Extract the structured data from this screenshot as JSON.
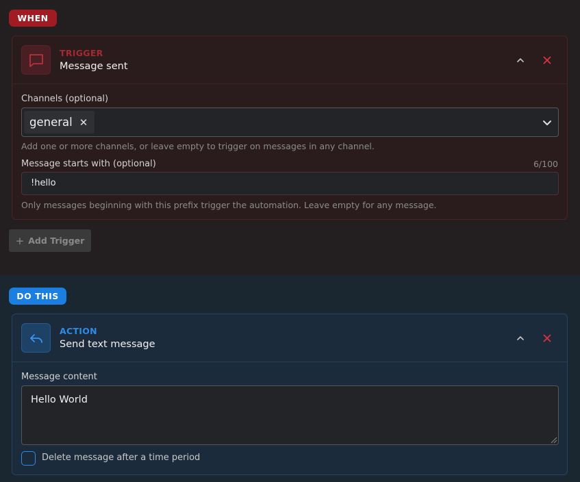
{
  "when": {
    "badge": "WHEN",
    "trigger": {
      "kicker": "TRIGGER",
      "title": "Message sent",
      "icon": "chat-bubble-icon",
      "channels": {
        "label": "Channels (optional)",
        "selected": [
          "general"
        ],
        "help": "Add one or more channels, or leave empty to trigger on messages in any channel."
      },
      "prefix": {
        "label": "Message starts with (optional)",
        "counter": "6/100",
        "value": "!hello",
        "help": "Only messages beginning with this prefix trigger the automation. Leave empty for any message."
      }
    },
    "add_trigger_label": "Add Trigger"
  },
  "do_this": {
    "badge": "DO THIS",
    "action": {
      "kicker": "ACTION",
      "title": "Send text message",
      "icon": "reply-arrow-icon",
      "content": {
        "label": "Message content",
        "value": "Hello World"
      },
      "delete_after": {
        "label": "Delete message after a time period",
        "checked": false
      }
    }
  },
  "colors": {
    "when_accent": "#a01c22",
    "do_accent": "#1a7fe0",
    "close_red": "#d8353d"
  }
}
